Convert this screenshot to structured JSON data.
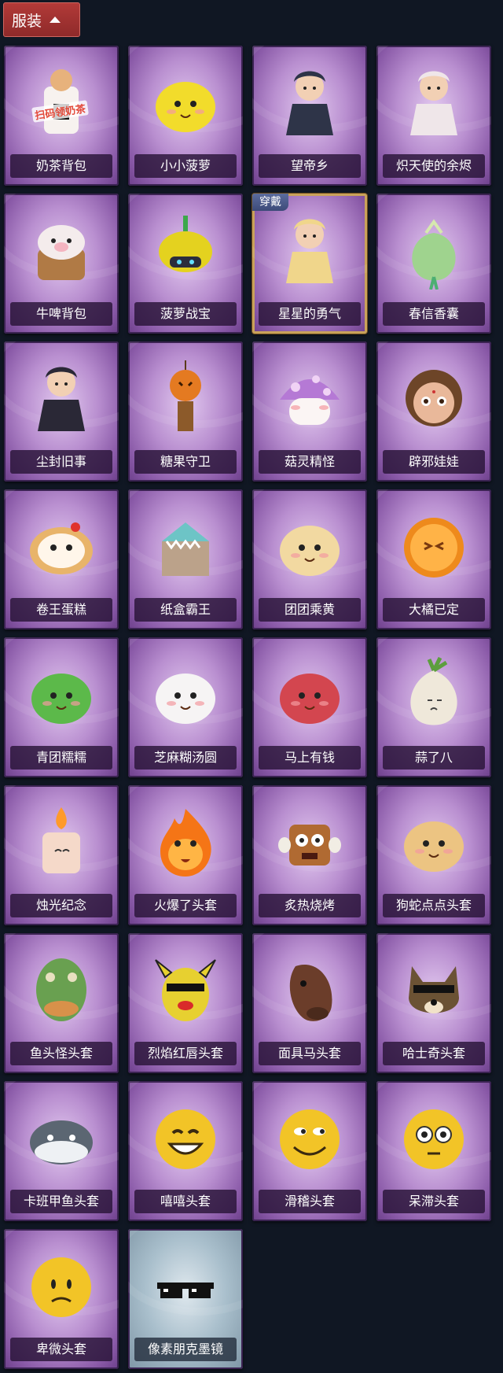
{
  "section": {
    "title": "服装"
  },
  "items": [
    {
      "label": "奶茶背包",
      "icon": "milk-tea-backpack-icon",
      "color": "#e7b27c",
      "art": "cup",
      "overlay": "扫码领奶茶"
    },
    {
      "label": "小小菠萝",
      "icon": "little-pineapple-icon",
      "color": "#f2dc2b",
      "art": "blob-face"
    },
    {
      "label": "望帝乡",
      "icon": "wangdixiang-figure-icon",
      "color": "#2e3448",
      "art": "figure"
    },
    {
      "label": "炽天使的余烬",
      "icon": "seraph-ember-figure-icon",
      "color": "#efe6e9",
      "art": "figure"
    },
    {
      "label": "牛啤背包",
      "icon": "cow-beer-backpack-icon",
      "color": "#b07a45",
      "art": "barrel"
    },
    {
      "label": "菠萝战宝",
      "icon": "pineapple-warrior-icon",
      "color": "#e4d21f",
      "art": "robot"
    },
    {
      "label": "星星的勇气",
      "icon": "star-courage-charm-icon",
      "color": "#f0d68b",
      "art": "figure",
      "badge": "穿戴",
      "selected": true
    },
    {
      "label": "春信香囊",
      "icon": "spring-sachet-icon",
      "color": "#9fd38e",
      "art": "sachet"
    },
    {
      "label": "尘封旧事",
      "icon": "dusty-past-charm-icon",
      "color": "#2a2836",
      "art": "figure"
    },
    {
      "label": "糖果守卫",
      "icon": "candy-guard-charm-icon",
      "color": "#e47a21",
      "art": "pumpkin"
    },
    {
      "label": "菇灵精怪",
      "icon": "mushroom-spirit-icon",
      "color": "#b579d5",
      "art": "mushroom"
    },
    {
      "label": "辟邪娃娃",
      "icon": "warding-doll-icon",
      "color": "#6d4528",
      "art": "doll"
    },
    {
      "label": "卷王蛋糕",
      "icon": "roll-cake-icon",
      "color": "#e8b46a",
      "art": "cake"
    },
    {
      "label": "纸盒霸王",
      "icon": "box-dino-icon",
      "color": "#6dc4c6",
      "art": "box"
    },
    {
      "label": "团团乘黄",
      "icon": "chenghuang-bun-icon",
      "color": "#f2d9a1",
      "art": "blob-face"
    },
    {
      "label": "大橘已定",
      "icon": "orange-slice-icon",
      "color": "#ee8a1c",
      "art": "orange"
    },
    {
      "label": "青团糯糯",
      "icon": "green-dumpling-icon",
      "color": "#5cb94a",
      "art": "blob-face"
    },
    {
      "label": "芝麻糊汤圆",
      "icon": "sesame-tangyuan-icon",
      "color": "#f6f4f4",
      "art": "blob-face"
    },
    {
      "label": "马上有钱",
      "icon": "horse-money-icon",
      "color": "#d3464f",
      "art": "blob-face"
    },
    {
      "label": "蒜了八",
      "icon": "garlic-icon",
      "color": "#efe8da",
      "art": "garlic"
    },
    {
      "label": "烛光纪念",
      "icon": "candle-icon",
      "color": "#f5d9c9",
      "art": "candle"
    },
    {
      "label": "火爆了头套",
      "icon": "fire-head-icon",
      "color": "#f57516",
      "art": "fire"
    },
    {
      "label": "炙热烧烤",
      "icon": "bbq-meat-icon",
      "color": "#b06a32",
      "art": "meat"
    },
    {
      "label": "狗蛇点点头套",
      "icon": "dog-snake-head-icon",
      "color": "#ecc482",
      "art": "blob-face"
    },
    {
      "label": "鱼头怪头套",
      "icon": "fish-head-mask-icon",
      "color": "#69a050",
      "art": "fishhead"
    },
    {
      "label": "烈焰红唇头套",
      "icon": "red-lips-mask-icon",
      "color": "#e7d030",
      "art": "pika"
    },
    {
      "label": "面具马头套",
      "icon": "horse-head-mask-icon",
      "color": "#6b3d2a",
      "art": "horse"
    },
    {
      "label": "哈士奇头套",
      "icon": "husky-head-mask-icon",
      "color": "#6b5234",
      "art": "dog"
    },
    {
      "label": "卡班甲鱼头套",
      "icon": "turtle-head-mask-icon",
      "color": "#5b6672",
      "art": "whale"
    },
    {
      "label": "嘻嘻头套",
      "icon": "grin-emoji-mask-icon",
      "color": "#f2c427",
      "art": "emoji-grin"
    },
    {
      "label": "滑稽头套",
      "icon": "funny-emoji-mask-icon",
      "color": "#f2c427",
      "art": "emoji-smirk"
    },
    {
      "label": "呆滞头套",
      "icon": "dazed-emoji-mask-icon",
      "color": "#f2c427",
      "art": "emoji-stare"
    },
    {
      "label": "卑微头套",
      "icon": "humble-emoji-mask-icon",
      "color": "#f2c427",
      "art": "emoji-sad"
    },
    {
      "label": "像素朋克墨镜",
      "icon": "pixel-sunglasses-icon",
      "color": "#111111",
      "art": "glasses",
      "rare": true
    }
  ]
}
